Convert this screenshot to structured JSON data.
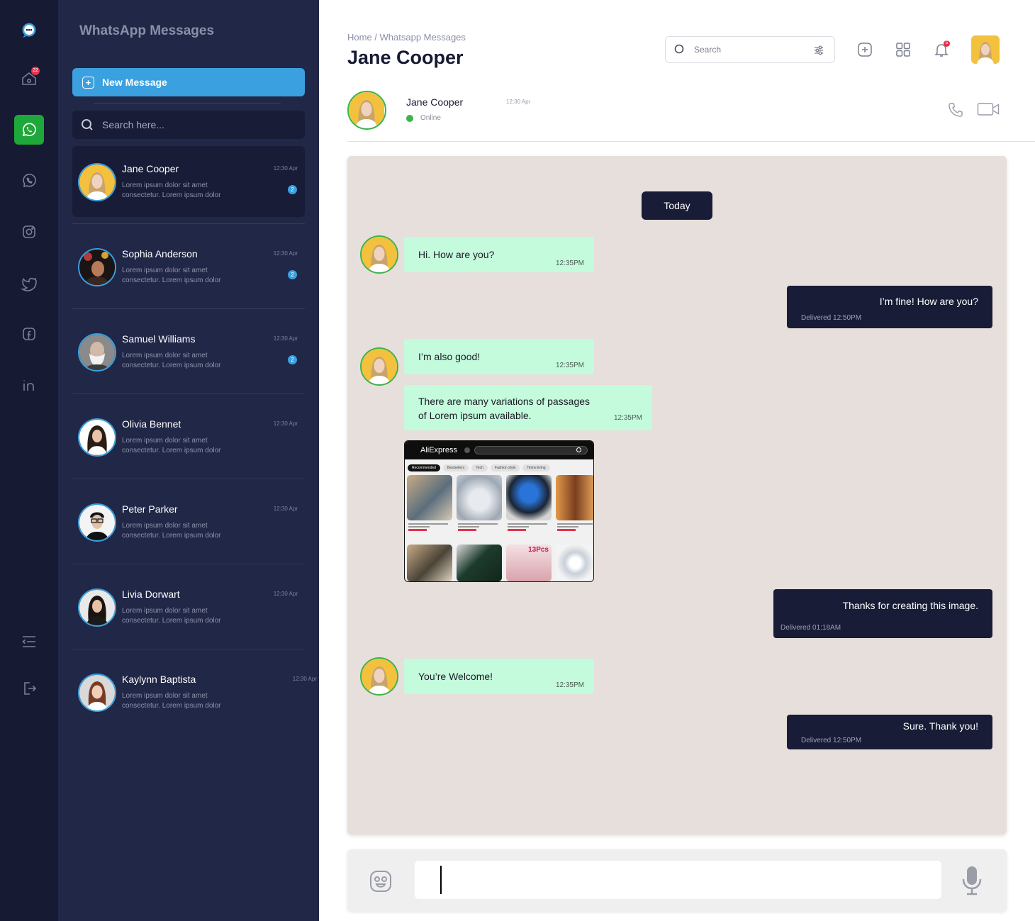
{
  "rail": {
    "logo": "chat-bubble-logo",
    "home_badge": "22",
    "items": [
      "home-icon",
      "whatsapp-icon",
      "viber-icon",
      "instagram-icon",
      "twitter-icon",
      "facebook-icon",
      "linkedin-icon"
    ],
    "bottom": [
      "menu-collapse-icon",
      "logout-icon"
    ],
    "active_color": "#1ea83a"
  },
  "sidebar": {
    "title": "WhatsApp Messages",
    "new_message_label": "New Message",
    "search_placeholder": "Search here...",
    "contacts": [
      {
        "name": "Jane Cooper",
        "time": "12:30 Apr",
        "preview": "Lorem ipsum dolor sit amet consectetur. Lorem ipsum dolor",
        "badge": "2"
      },
      {
        "name": "Sophia Anderson",
        "time": "12:30 Apr",
        "preview": "Lorem ipsum dolor sit amet consectetur. Lorem ipsum dolor",
        "badge": "2"
      },
      {
        "name": "Samuel Williams",
        "time": "12:30 Apr",
        "preview": "Lorem ipsum dolor sit amet consectetur. Lorem ipsum dolor",
        "badge": "2"
      },
      {
        "name": "Olivia Bennet",
        "time": "12:30 Apr",
        "preview": "Lorem ipsum dolor sit amet consectetur. Lorem ipsum dolor",
        "badge": ""
      },
      {
        "name": "Peter Parker",
        "time": "12:30 Apr",
        "preview": "Lorem ipsum dolor sit amet consectetur. Lorem ipsum dolor",
        "badge": ""
      },
      {
        "name": "Livia Dorwart",
        "time": "12:30 Apr",
        "preview": "Lorem ipsum dolor sit amet consectetur. Lorem ipsum dolor",
        "badge": ""
      },
      {
        "name": "Kaylynn Baptista",
        "time": "12:30 Apr",
        "preview": "Lorem ipsum dolor sit amet consectetur. Lorem ipsum dolor",
        "badge": ""
      }
    ],
    "accent": "#3aa0df"
  },
  "header": {
    "breadcrumb": "Home / Whatsapp Messages",
    "title": "Jane Cooper",
    "search_placeholder": "Search",
    "notification_count": "5"
  },
  "chat": {
    "contact_name": "Jane Cooper",
    "contact_time": "12:30 Apr",
    "status": "Online",
    "day_label": "Today",
    "messages": [
      {
        "dir": "in",
        "text": "Hi. How are you?",
        "time": "12:35PM"
      },
      {
        "dir": "out",
        "text": "I’m fine! How are you?",
        "status": "Delivered 12:50PM"
      },
      {
        "dir": "in",
        "text": "I’m also good!",
        "time": "12:35PM"
      },
      {
        "dir": "in",
        "text": "There are many variations of passages of Lorem ipsum available.",
        "time": "12:35PM"
      },
      {
        "dir": "in",
        "type": "image",
        "caption_logo": "AliExpress",
        "tabs": [
          "Recommended",
          "Bestsellers",
          "Tech",
          "Fashion style",
          "Home living"
        ],
        "promo": "13Pcs"
      },
      {
        "dir": "out",
        "text": "Thanks for creating this image.",
        "status": "Delivered 01:18AM"
      },
      {
        "dir": "in",
        "text": "You’re Welcome!",
        "time": "12:35PM"
      },
      {
        "dir": "out",
        "text": "Sure. Thank you!",
        "status": "Delivered 12:50PM"
      }
    ],
    "incoming_color": "#c3fbdc",
    "outgoing_color": "#181c36"
  },
  "composer": {
    "placeholder": ""
  }
}
